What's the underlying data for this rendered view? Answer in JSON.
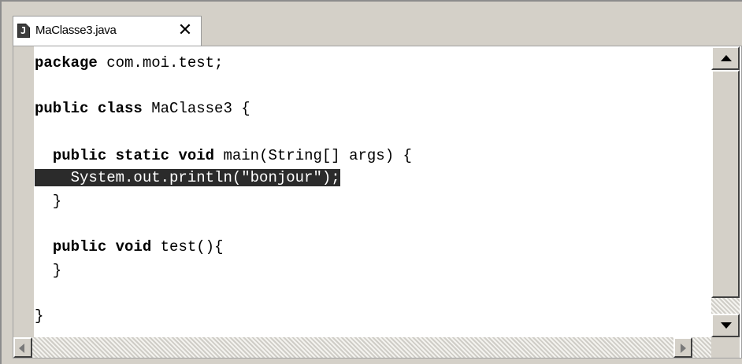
{
  "tab": {
    "title": "MaClasse3.java",
    "close_label": "✕",
    "file_icon_letter": "J"
  },
  "editor": {
    "lines": [
      [
        {
          "t": "package",
          "kw": true
        },
        {
          "t": " com.moi.test;"
        }
      ],
      [],
      [
        {
          "t": "public",
          "kw": true
        },
        {
          "t": " "
        },
        {
          "t": "class",
          "kw": true
        },
        {
          "t": " MaClasse3 {"
        }
      ],
      [],
      [
        {
          "t": "  "
        },
        {
          "t": "public",
          "kw": true
        },
        {
          "t": " "
        },
        {
          "t": "static",
          "kw": true
        },
        {
          "t": " "
        },
        {
          "t": "void",
          "kw": true
        },
        {
          "t": " main(String[] args) {"
        }
      ],
      [
        {
          "t": "    System.out.println(\"bonjour\");",
          "hl": true
        }
      ],
      [
        {
          "t": "  }"
        }
      ],
      [],
      [
        {
          "t": "  "
        },
        {
          "t": "public",
          "kw": true
        },
        {
          "t": " "
        },
        {
          "t": "void",
          "kw": true
        },
        {
          "t": " test(){"
        }
      ],
      [
        {
          "t": "  }"
        }
      ],
      [],
      [
        {
          "t": "}"
        }
      ]
    ],
    "highlighted_line": 6
  },
  "icons": {
    "scroll_up": "arrow-up-icon",
    "scroll_down": "arrow-down-icon",
    "scroll_left": "arrow-left-icon",
    "scroll_right": "arrow-right-icon",
    "file": "java-file-icon",
    "close": "close-icon"
  },
  "colors": {
    "highlight_bg": "#2b2b2b",
    "highlight_fg": "#ffffff",
    "chrome": "#d4d0c8"
  }
}
